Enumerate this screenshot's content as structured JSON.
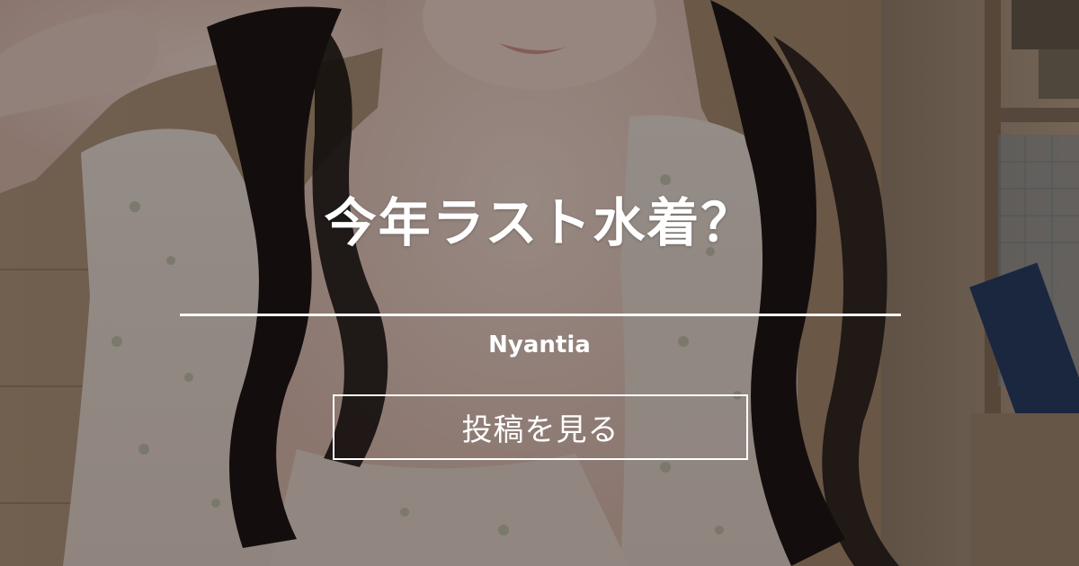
{
  "post": {
    "title": "今年ラスト水着？",
    "author": "Nyantia"
  },
  "actions": {
    "view_post_label": "投稿を見る"
  },
  "colors": {
    "text": "#ffffff",
    "divider": "#ffffff",
    "button_border": "#ffffff",
    "overlay": "rgba(0,0,0,0.38)"
  }
}
